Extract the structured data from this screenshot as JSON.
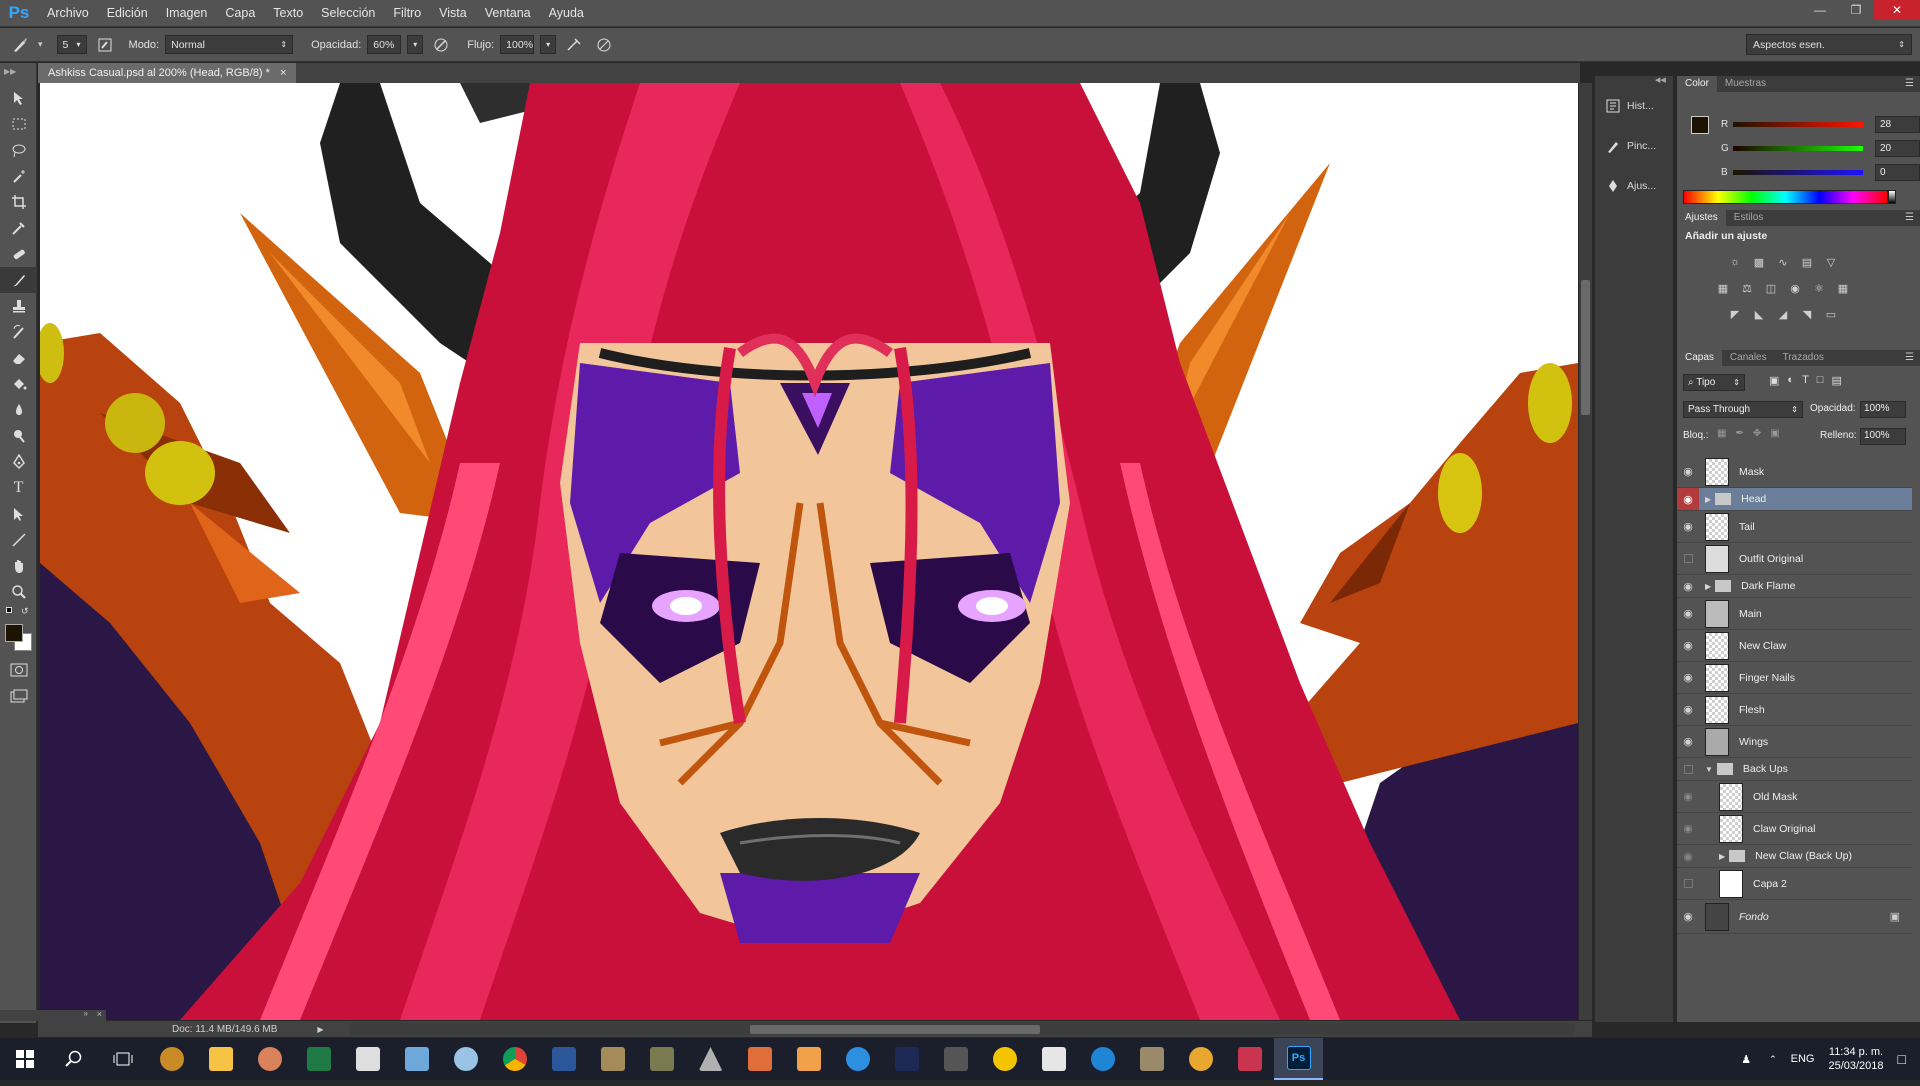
{
  "menubar": {
    "logo": "Ps",
    "items": [
      "Archivo",
      "Edición",
      "Imagen",
      "Capa",
      "Texto",
      "Selección",
      "Filtro",
      "Vista",
      "Ventana",
      "Ayuda"
    ]
  },
  "options": {
    "brush_size": "5",
    "mode_label": "Modo:",
    "mode_value": "Normal",
    "opacity_label": "Opacidad:",
    "opacity_value": "60%",
    "flow_label": "Flujo:",
    "flow_value": "100%",
    "workspace": "Aspectos esen."
  },
  "document": {
    "tab_title": "Ashkiss Casual.psd al 200% (Head, RGB/8) *",
    "close": "×",
    "status": "Doc: 11.4 MB/149.6 MB"
  },
  "mini_panels": [
    {
      "icon": "history-icon",
      "label": "Hist..."
    },
    {
      "icon": "brush-presets-icon",
      "label": "Pinc..."
    },
    {
      "icon": "adjust-icon",
      "label": "Ajus..."
    }
  ],
  "color_panel": {
    "tabs": [
      "Color",
      "Muestras"
    ],
    "channels": [
      {
        "name": "R",
        "value": "28",
        "color": "#d02020"
      },
      {
        "name": "G",
        "value": "20",
        "color": "#20b020"
      },
      {
        "name": "B",
        "value": "0",
        "color": "#2030d0"
      }
    ]
  },
  "adjust_panel": {
    "tabs": [
      "Ajustes",
      "Estilos"
    ],
    "title": "Añadir un ajuste"
  },
  "layers_panel": {
    "tabs": [
      "Capas",
      "Canales",
      "Trazados"
    ],
    "filter": "Tipo",
    "blend_mode": "Pass Through",
    "opacity_label": "Opacidad:",
    "opacity_value": "100%",
    "lock_label": "Bloq.:",
    "fill_label": "Relleno:",
    "fill_value": "100%",
    "layers": [
      {
        "name": "Mask",
        "visible": true
      },
      {
        "name": "Head",
        "visible": true,
        "group": true,
        "selected": true
      },
      {
        "name": "Tail",
        "visible": true
      },
      {
        "name": "Outfit Original",
        "visible": false
      },
      {
        "name": "Dark Flame",
        "visible": true,
        "group": true
      },
      {
        "name": "Main",
        "visible": true
      },
      {
        "name": "New Claw",
        "visible": true
      },
      {
        "name": "Finger Nails",
        "visible": true
      },
      {
        "name": "Flesh",
        "visible": true
      },
      {
        "name": "Wings",
        "visible": true
      },
      {
        "name": "Back Ups",
        "visible": false,
        "group": true,
        "open": true
      },
      {
        "name": "Old Mask",
        "visible": true,
        "indent": true
      },
      {
        "name": "Claw Original",
        "visible": true,
        "indent": true
      },
      {
        "name": "New Claw (Back Up)",
        "visible": true,
        "indent": true,
        "group": true
      },
      {
        "name": "Capa 2",
        "visible": false
      },
      {
        "name": "Fondo",
        "visible": true,
        "locked": true
      }
    ]
  },
  "taskbar": {
    "lang": "ENG",
    "time": "11:34 p. m.",
    "date": "25/03/2018"
  }
}
